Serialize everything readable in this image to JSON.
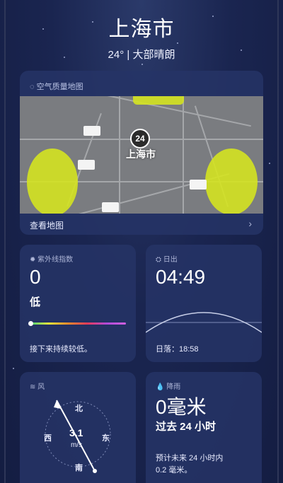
{
  "header": {
    "city": "上海市",
    "condition": "24° | 大部晴朗"
  },
  "map_card": {
    "title": "空气质量地图",
    "marker_value": "24",
    "map_city": "上海市",
    "view_map_label": "查看地图",
    "chevron": "›"
  },
  "uv_card": {
    "title": "紫外线指数",
    "value": "0",
    "level": "低",
    "note": "接下来持续较低。",
    "level_fraction": 0.0
  },
  "sun_card": {
    "title": "日出",
    "sunrise": "04:49",
    "sunset_label": "日落：18:58"
  },
  "wind_card": {
    "title": "风",
    "north": "北",
    "south": "南",
    "east": "东",
    "west": "西",
    "speed": "3.1",
    "unit": "m/s"
  },
  "rain_card": {
    "title": "降雨",
    "amount": "0毫米",
    "period": "过去 24 小时",
    "forecast_line1": "预计未来 24 小时内",
    "forecast_line2": "0.2 毫米。"
  },
  "colors": {
    "background": "#1a2550",
    "card": "#263466",
    "aqi_yellow": "#d6e61e"
  }
}
